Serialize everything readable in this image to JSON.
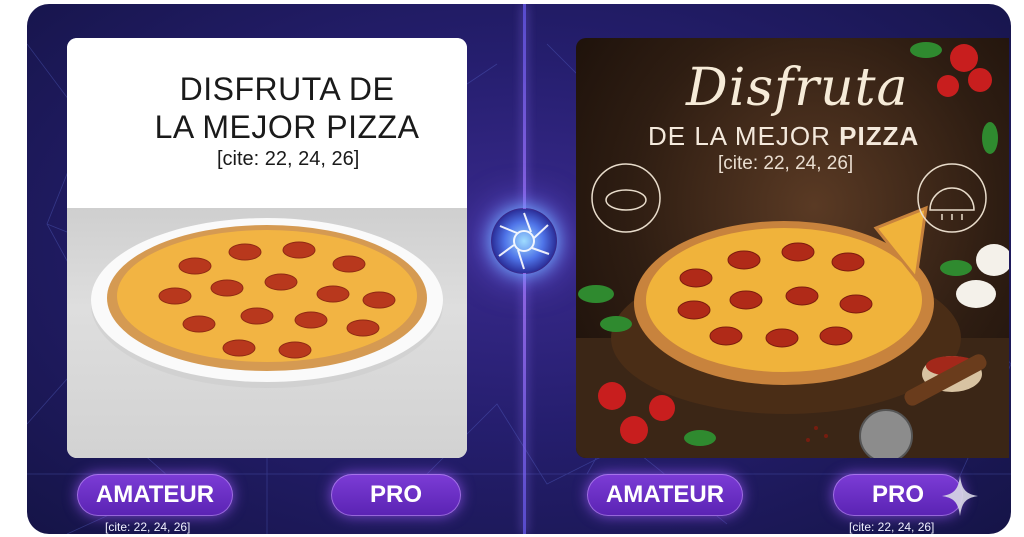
{
  "left_panel": {
    "title_line1": "DISFRUTA DE",
    "title_line2": "LA MEJOR PIZZA",
    "cite": "[cite: 22, 24, 26]"
  },
  "right_panel": {
    "title_script": "Disfruta",
    "title_sub_prefix": "DE LA MEJOR ",
    "title_sub_bold": "PIZZA",
    "cite": "[cite: 22, 24, 26]"
  },
  "buttons": {
    "left_amateur": "AMATEUR",
    "left_pro": "PRO",
    "right_amateur": "AMATEUR",
    "right_pro": "PRO"
  },
  "footer_cites": {
    "left": "[cite: 22, 24, 26]",
    "right": "[cite: 22, 24, 26]"
  },
  "colors": {
    "background_deep": "#151447",
    "background_mid": "#3a2a8e",
    "button_purple": "#6a2fc8",
    "divider_glow": "#b07bff"
  },
  "icons": [
    "aperture-logo-icon",
    "sparkle-icon",
    "pizza-dough-icon",
    "pizza-oven-icon"
  ]
}
